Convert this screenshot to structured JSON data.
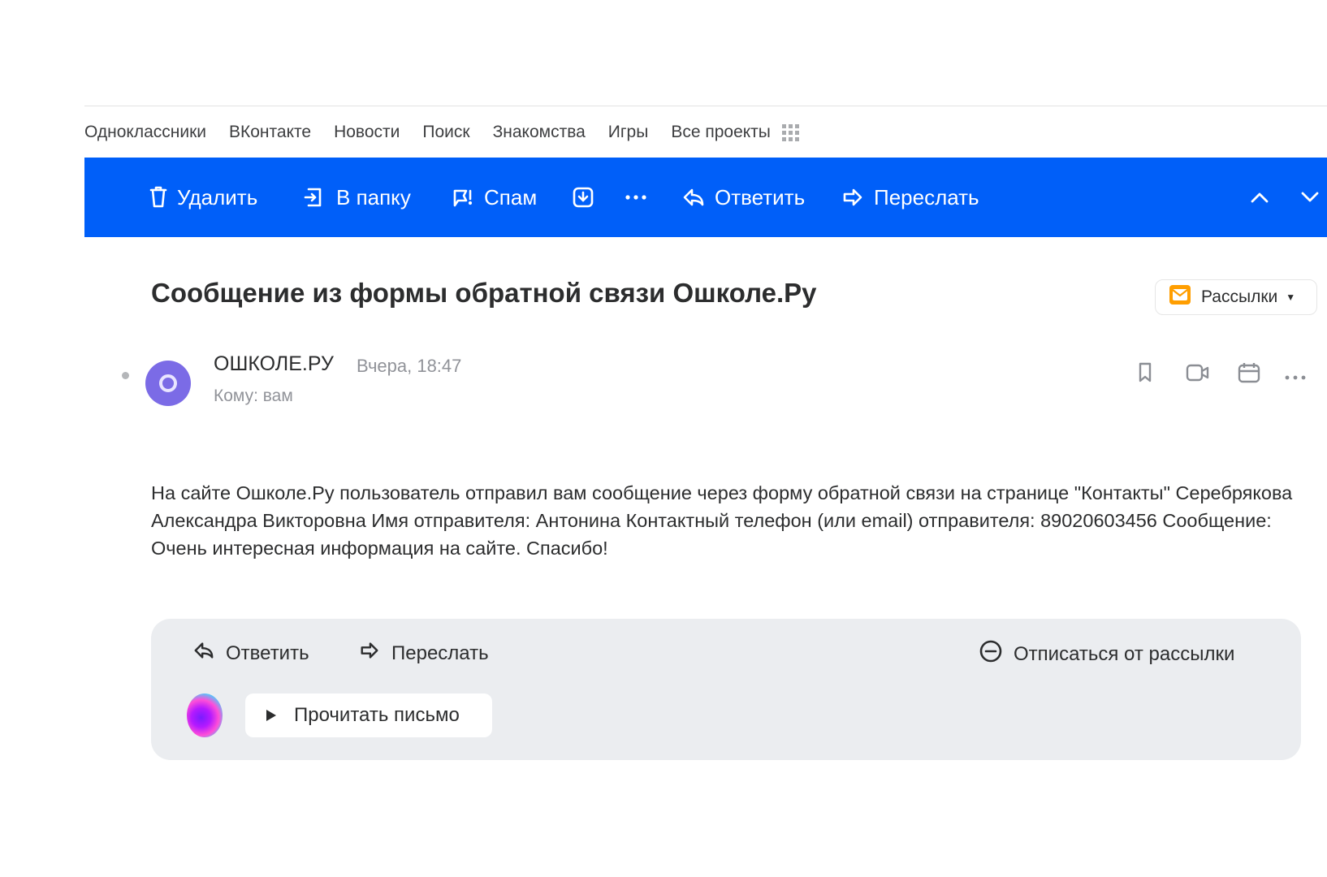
{
  "portal_nav": {
    "items": [
      "Одноклассники",
      "ВКонтакте",
      "Новости",
      "Поиск",
      "Знакомства",
      "Игры",
      "Все проекты"
    ],
    "grid_icon": "grid-icon"
  },
  "toolbar": {
    "delete_label": "Удалить",
    "move_label": "В папку",
    "spam_label": "Спам",
    "archive_icon": "archive-icon",
    "more_icon": "more-dots-icon",
    "reply_label": "Ответить",
    "forward_label": "Переслать",
    "prev_icon": "chevron-up-icon",
    "next_icon": "chevron-down-icon",
    "background_color": "#005ff9"
  },
  "message": {
    "subject": "Сообщение из формы обратной связи Ошколе.Ру",
    "category_label": "Рассылки",
    "avatar_color": "#7b6be6",
    "sender": "ОШКОЛЕ.РУ",
    "date": "Вчера, 18:47",
    "to_prefix": "Кому:",
    "to_value": "вам",
    "header_icons": [
      "bookmark-icon",
      "video-call-icon",
      "calendar-icon",
      "more-dots-icon"
    ],
    "body": "На сайте Ошколе.Ру пользователь отправил вам сообщение через форму обратной связи на странице \"Контакты\" Серебрякова Александра Викторовна Имя отправителя: Антонина Контактный телефон (или email) отправителя: 89020603456 Сообщение: Очень интересная информация на сайте. Спасибо!"
  },
  "actions": {
    "reply_label": "Ответить",
    "forward_label": "Переслать",
    "unsubscribe_label": "Отписаться от рассылки",
    "read_aloud_label": "Прочитать письмо"
  }
}
